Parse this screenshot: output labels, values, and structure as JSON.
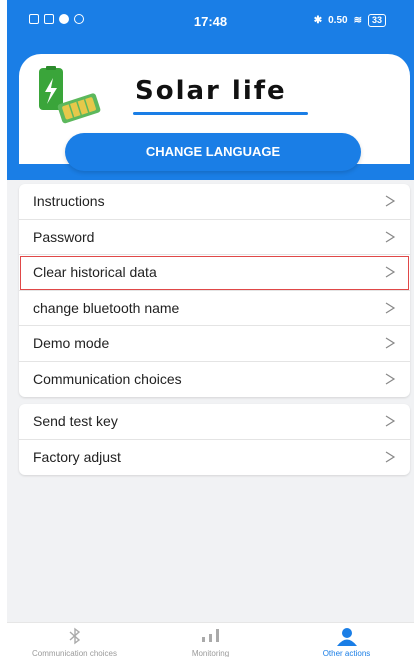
{
  "status_bar": {
    "time": "17:48",
    "network": "0.50",
    "battery": "33"
  },
  "header": {
    "app_title": "Solar life",
    "language_button": "CHANGE LANGUAGE"
  },
  "menu_group_1": [
    {
      "label": "Instructions",
      "highlighted": false
    },
    {
      "label": "Password",
      "highlighted": false
    },
    {
      "label": "Clear historical data",
      "highlighted": true
    },
    {
      "label": "change bluetooth name",
      "highlighted": false
    },
    {
      "label": "Demo mode",
      "highlighted": false
    },
    {
      "label": "Communication choices",
      "highlighted": false
    }
  ],
  "menu_group_2": [
    {
      "label": "Send test key"
    },
    {
      "label": "Factory adjust"
    }
  ],
  "tabs": [
    {
      "label": "Communication choices",
      "icon": "bluetooth-icon",
      "active": false
    },
    {
      "label": "Monitoring",
      "icon": "signal-bars-icon",
      "active": false
    },
    {
      "label": "Other actions",
      "icon": "person-icon",
      "active": true
    }
  ],
  "colors": {
    "accent": "#1a7ee6",
    "highlight_border": "#e04848",
    "background": "#f1f2f4"
  }
}
